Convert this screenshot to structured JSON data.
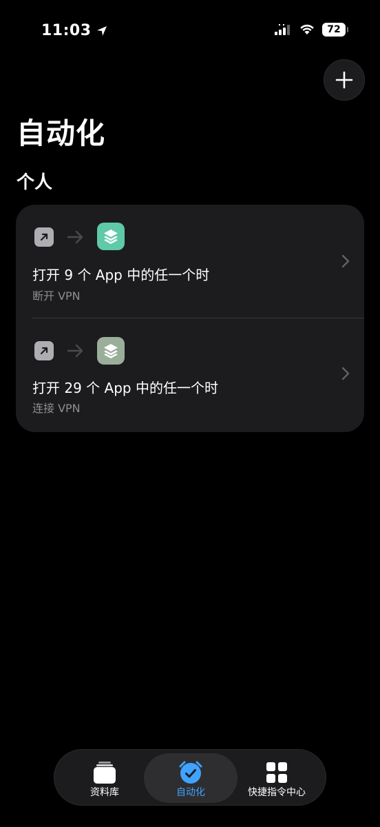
{
  "status_bar": {
    "time": "11:03",
    "battery": "72"
  },
  "header": {
    "add_label": "+"
  },
  "page": {
    "title": "自动化",
    "section_title": "个人"
  },
  "automations": [
    {
      "title": "打开 9 个 App 中的任一个时",
      "subtitle": "断开 VPN",
      "action_icon_color": "#5fc9a8"
    },
    {
      "title": "打开 29 个 App 中的任一个时",
      "subtitle": "连接 VPN",
      "action_icon_color": "#9aae9a"
    }
  ],
  "tab_bar": {
    "items": [
      {
        "label": "资料库",
        "icon": "library-icon",
        "selected": false
      },
      {
        "label": "自动化",
        "icon": "automation-clock-icon",
        "selected": true
      },
      {
        "label": "快捷指令中心",
        "icon": "gallery-grid-icon",
        "selected": false
      }
    ]
  },
  "colors": {
    "background": "#000000",
    "card": "#1c1c1e",
    "accent": "#3fa3ff",
    "secondary_text": "#8e8e93"
  }
}
